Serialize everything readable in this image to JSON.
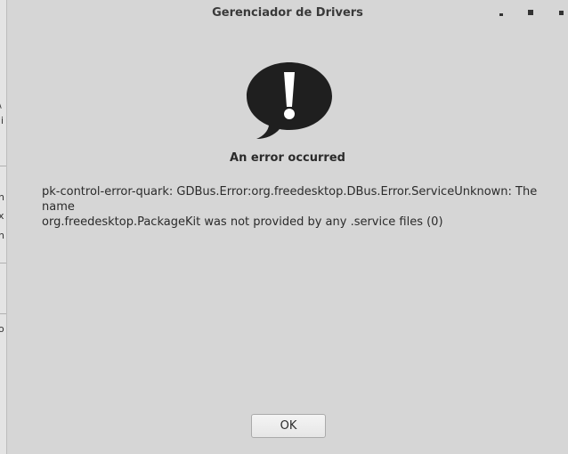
{
  "window": {
    "title": "Gerenciador de Drivers"
  },
  "dialog": {
    "icon": "dialog-error-speech-bubble-icon",
    "heading": "An error occurred",
    "message_line1": "pk-control-error-quark: GDBus.Error:org.freedesktop.DBus.Error.ServiceUnknown: The name",
    "message_line2": "org.freedesktop.PackageKit was not provided by any .service files (0)",
    "ok_label": "OK"
  },
  "background_window": {
    "glyphs": [
      "\\",
      "li",
      "n",
      "x",
      "n",
      "o"
    ]
  },
  "colors": {
    "background": "#d6d6d6",
    "icon": "#1f1f1f",
    "text": "#2b2b2b"
  }
}
